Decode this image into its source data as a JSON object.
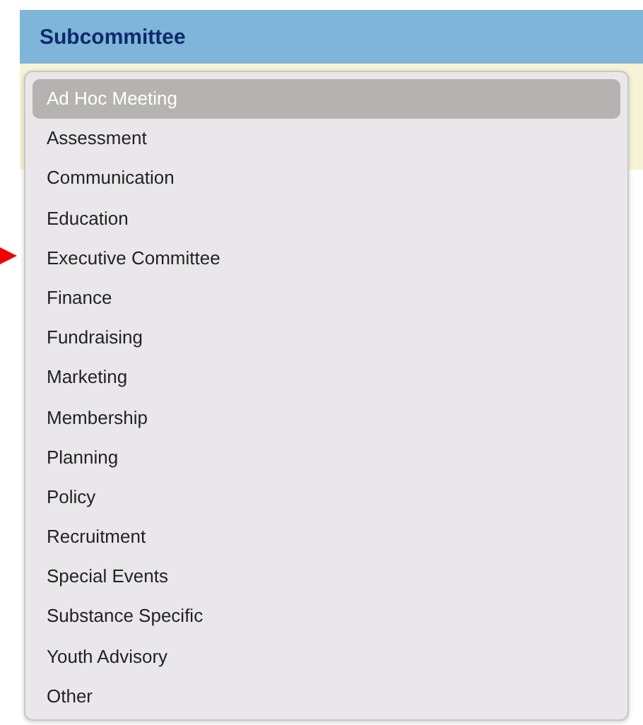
{
  "header": {
    "title": "Subcommittee"
  },
  "dropdown": {
    "options": [
      {
        "label": "Ad Hoc Meeting",
        "selected": true
      },
      {
        "label": "Assessment",
        "selected": false
      },
      {
        "label": "Communication",
        "selected": false
      },
      {
        "label": "Education",
        "selected": false
      },
      {
        "label": "Executive Committee",
        "selected": false
      },
      {
        "label": "Finance",
        "selected": false
      },
      {
        "label": "Fundraising",
        "selected": false
      },
      {
        "label": "Marketing",
        "selected": false
      },
      {
        "label": "Membership",
        "selected": false
      },
      {
        "label": "Planning",
        "selected": false
      },
      {
        "label": "Policy",
        "selected": false
      },
      {
        "label": "Recruitment",
        "selected": false
      },
      {
        "label": "Special Events",
        "selected": false
      },
      {
        "label": "Substance Specific",
        "selected": false
      },
      {
        "label": "Youth Advisory",
        "selected": false
      },
      {
        "label": "Other",
        "selected": false
      }
    ]
  }
}
